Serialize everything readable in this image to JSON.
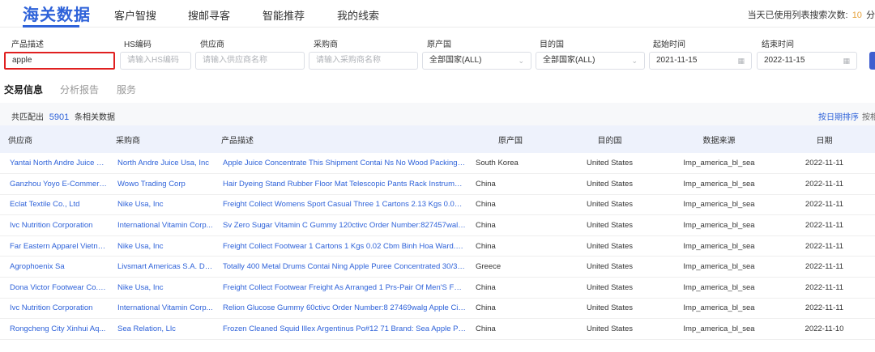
{
  "nav": {
    "brand": "海关数据",
    "tabs": [
      "客户智搜",
      "搜邮寻客",
      "智能推荐",
      "我的线索"
    ],
    "quota_label": "当天已使用列表搜索次数:",
    "quota_count": "10",
    "quota_suffix": "分"
  },
  "filters": {
    "product": {
      "label": "产品描述",
      "value": "apple"
    },
    "hs": {
      "label": "HS编码",
      "placeholder": "请输入HS编码"
    },
    "supplier": {
      "label": "供应商",
      "placeholder": "请输入供应商名称"
    },
    "buyer": {
      "label": "采购商",
      "placeholder": "请输入采购商名称"
    },
    "origin": {
      "label": "原产国",
      "value": "全部国家(ALL)"
    },
    "dest": {
      "label": "目的国",
      "value": "全部国家(ALL)"
    },
    "start": {
      "label": "起始时间",
      "value": "2021-11-15"
    },
    "end": {
      "label": "结束时间",
      "value": "2022-11-15"
    }
  },
  "subtabs": [
    "交易信息",
    "分析报告",
    "服务"
  ],
  "results": {
    "prefix": "共匹配出",
    "count": "5901",
    "suffix": "条相关数据",
    "sort_date": "按日期排序",
    "sort_other": "按相"
  },
  "table": {
    "headers": [
      "供应商",
      "采购商",
      "产品描述",
      "原产国",
      "目的国",
      "数据来源",
      "日期"
    ],
    "rows": [
      [
        "Yantai North Andre Juice C...",
        "North Andre Juice Usa, Inc",
        "Apple Juice Concentrate This Shipment Contai Ns No Wood Packing ...",
        "South Korea",
        "United States",
        "Imp_america_bl_sea",
        "2022-11-11"
      ],
      [
        "Ganzhou Yoyo E-Commerc...",
        "Wowo Trading Corp",
        "Hair Dyeing Stand Rubber Floor Mat Telescopic Pants Rack Instrument ...",
        "China",
        "United States",
        "Imp_america_bl_sea",
        "2022-11-11"
      ],
      [
        "Eclat Textile Co., Ltd",
        "Nike Usa, Inc",
        "Freight Collect Womens Sport Casual Three 1 Cartons 2.13 Kgs 0.04 C...",
        "China",
        "United States",
        "Imp_america_bl_sea",
        "2022-11-11"
      ],
      [
        "Ivc Nutrition Corporation",
        "International Vitamin Corp...",
        "Sv Zero Sugar Vitamin C Gummy 120ctivc Order Number:827457walg ...",
        "China",
        "United States",
        "Imp_america_bl_sea",
        "2022-11-11"
      ],
      [
        "Far Eastern Apparel Vietna...",
        "Nike Usa, Inc",
        "Freight Collect Footwear 1 Cartons 1 Kgs 0.02 Cbm Binh Hoa Ward.Th...",
        "China",
        "United States",
        "Imp_america_bl_sea",
        "2022-11-11"
      ],
      [
        "Agrophoenix Sa",
        "Livsmart Americas S.A. De ...",
        "Totally 400 Metal Drums Contai Ning Apple Puree Concentrated 30/32...",
        "Greece",
        "United States",
        "Imp_america_bl_sea",
        "2022-11-11"
      ],
      [
        "Dona Victor Footwear Co., ...",
        "Nike Usa, Inc",
        "Freight Collect Footwear Freight As Arranged 1 Prs-Pair Of Men'S Foot...",
        "China",
        "United States",
        "Imp_america_bl_sea",
        "2022-11-11"
      ],
      [
        "Ivc Nutrition Corporation",
        "International Vitamin Corp...",
        "Relion Glucose Gummy 60ctivc Order Number:8 27469walg Apple Cid...",
        "China",
        "United States",
        "Imp_america_bl_sea",
        "2022-11-11"
      ],
      [
        "Rongcheng City Xinhui Aq...",
        "Sea Relation, Llc",
        "Frozen Cleaned Squid Illex Argentinus Po#12 71 Brand: Sea Apple Pro...",
        "China",
        "United States",
        "Imp_america_bl_sea",
        "2022-11-10"
      ]
    ]
  }
}
